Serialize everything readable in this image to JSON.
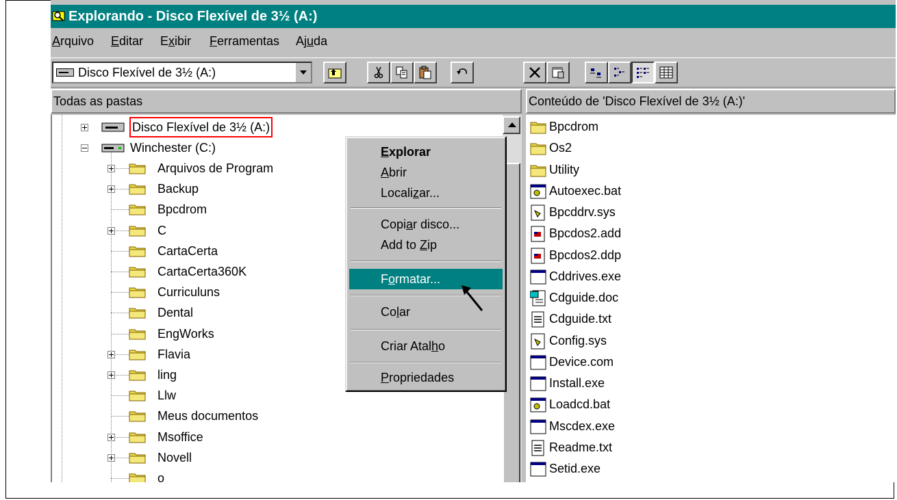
{
  "window": {
    "title": "Explorando - Disco Flexível de 3½ (A:)"
  },
  "menu": {
    "items": [
      {
        "label": "Arquivo",
        "accel": "A",
        "rest": "rquivo"
      },
      {
        "label": "Editar",
        "accel": "E",
        "rest": "ditar"
      },
      {
        "label": "Exibir",
        "pre": "E",
        "accel": "x",
        "rest": "ibir"
      },
      {
        "label": "Ferramentas",
        "accel": "F",
        "rest": "erramentas"
      },
      {
        "label": "Ajuda",
        "pre": "Aj",
        "accel": "u",
        "rest": "da"
      }
    ]
  },
  "toolbar": {
    "drive_combo_value": "Disco Flexível de 3½ (A:)",
    "buttons": [
      "up-one-level",
      "cut",
      "copy",
      "paste",
      "undo",
      "delete",
      "properties",
      "large-icons",
      "small-icons",
      "list",
      "details"
    ],
    "pressed": "list"
  },
  "left_pane": {
    "header": "Todas as pastas",
    "tree": [
      {
        "label": "Disco Flexível de 3½ (A:)",
        "level": 0,
        "expander": "plus",
        "icon": "floppy-drive-icon",
        "selected": true
      },
      {
        "label": "Winchester (C:)",
        "level": 0,
        "expander": "minus",
        "icon": "hard-drive-icon"
      },
      {
        "label": "Arquivos de Program",
        "level": 1,
        "expander": "plus",
        "icon": "folder-icon"
      },
      {
        "label": "Backup",
        "level": 1,
        "expander": "plus",
        "icon": "folder-icon"
      },
      {
        "label": "Bpcdrom",
        "level": 1,
        "expander": "",
        "icon": "folder-icon"
      },
      {
        "label": "C",
        "level": 1,
        "expander": "plus",
        "icon": "folder-icon"
      },
      {
        "label": "CartaCerta",
        "level": 1,
        "expander": "",
        "icon": "folder-icon"
      },
      {
        "label": "CartaCerta360K",
        "level": 1,
        "expander": "",
        "icon": "folder-icon"
      },
      {
        "label": "Curriculuns",
        "level": 1,
        "expander": "",
        "icon": "folder-icon"
      },
      {
        "label": "Dental",
        "level": 1,
        "expander": "",
        "icon": "folder-icon"
      },
      {
        "label": "EngWorks",
        "level": 1,
        "expander": "",
        "icon": "folder-icon"
      },
      {
        "label": "Flavia",
        "level": 1,
        "expander": "plus",
        "icon": "folder-icon"
      },
      {
        "label": "ling",
        "level": 1,
        "expander": "plus",
        "icon": "folder-icon"
      },
      {
        "label": "Llw",
        "level": 1,
        "expander": "",
        "icon": "folder-icon"
      },
      {
        "label": "Meus documentos",
        "level": 1,
        "expander": "",
        "icon": "folder-icon"
      },
      {
        "label": "Msoffice",
        "level": 1,
        "expander": "plus",
        "icon": "folder-icon"
      },
      {
        "label": "Novell",
        "level": 1,
        "expander": "plus",
        "icon": "folder-icon"
      },
      {
        "label": "o",
        "level": 1,
        "expander": "",
        "icon": "folder-icon"
      }
    ]
  },
  "right_pane": {
    "header": "Conteúdo de 'Disco Flexível de 3½ (A:)'",
    "items": [
      {
        "label": "Bpcdrom",
        "icon": "folder-icon"
      },
      {
        "label": "Os2",
        "icon": "folder-icon"
      },
      {
        "label": "Utility",
        "icon": "folder-icon"
      },
      {
        "label": "Autoexec.bat",
        "icon": "batch-file-icon"
      },
      {
        "label": "Bpcddrv.sys",
        "icon": "system-file-icon"
      },
      {
        "label": "Bpcdos2.add",
        "icon": "generic-file-icon"
      },
      {
        "label": "Bpcdos2.ddp",
        "icon": "generic-file-icon"
      },
      {
        "label": "Cddrives.exe",
        "icon": "executable-icon"
      },
      {
        "label": "Cdguide.doc",
        "icon": "wordpad-doc-icon"
      },
      {
        "label": "Cdguide.txt",
        "icon": "text-file-icon"
      },
      {
        "label": "Config.sys",
        "icon": "system-file-icon"
      },
      {
        "label": "Device.com",
        "icon": "executable-icon"
      },
      {
        "label": "Install.exe",
        "icon": "executable-icon"
      },
      {
        "label": "Loadcd.bat",
        "icon": "batch-file-icon"
      },
      {
        "label": "Mscdex.exe",
        "icon": "executable-icon"
      },
      {
        "label": "Readme.txt",
        "icon": "text-file-icon"
      },
      {
        "label": "Setid.exe",
        "icon": "executable-icon"
      }
    ]
  },
  "context_menu": {
    "items": [
      {
        "pre": "",
        "accel": "E",
        "rest": "xplorar",
        "bold": true
      },
      {
        "pre": "",
        "accel": "A",
        "rest": "brir"
      },
      {
        "pre": "Locali",
        "accel": "z",
        "rest": "ar..."
      },
      {
        "pre": "Copi",
        "accel": "a",
        "rest": "r disco..."
      },
      {
        "pre": "Add to ",
        "accel": "Z",
        "rest": "ip"
      },
      {
        "pre": "F",
        "accel": "o",
        "rest": "rmatar...",
        "highlighted": true
      },
      {
        "pre": "Co",
        "accel": "l",
        "rest": "ar"
      },
      {
        "pre": "Criar Atal",
        "accel": "h",
        "rest": "o"
      },
      {
        "pre": "",
        "accel": "P",
        "rest": "ropriedades"
      }
    ]
  },
  "colors": {
    "title_bar": "#008080",
    "face": "#c0c0c0",
    "highlight": "#008080"
  }
}
